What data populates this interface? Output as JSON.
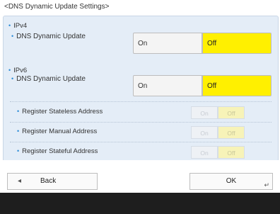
{
  "title": "<DNS Dynamic Update Settings>",
  "ipv4": {
    "group_label": "IPv4",
    "row_label": "DNS Dynamic Update",
    "on_label": "On",
    "off_label": "Off",
    "selected": "Off"
  },
  "ipv6": {
    "group_label": "IPv6",
    "row_label": "DNS Dynamic Update",
    "on_label": "On",
    "off_label": "Off",
    "selected": "Off",
    "sub_settings": [
      {
        "label": "Register Stateless Address",
        "on_label": "On",
        "off_label": "Off",
        "selected": "Off",
        "enabled": false
      },
      {
        "label": "Register Manual Address",
        "on_label": "On",
        "off_label": "Off",
        "selected": "Off",
        "enabled": false
      },
      {
        "label": "Register Stateful Address",
        "on_label": "On",
        "off_label": "Off",
        "selected": "Off",
        "enabled": false
      }
    ]
  },
  "footer": {
    "back_label": "Back",
    "ok_label": "OK"
  },
  "colors": {
    "selected": "#fff000",
    "panel": "#e4edf7",
    "accent": "#2b8bd6"
  }
}
